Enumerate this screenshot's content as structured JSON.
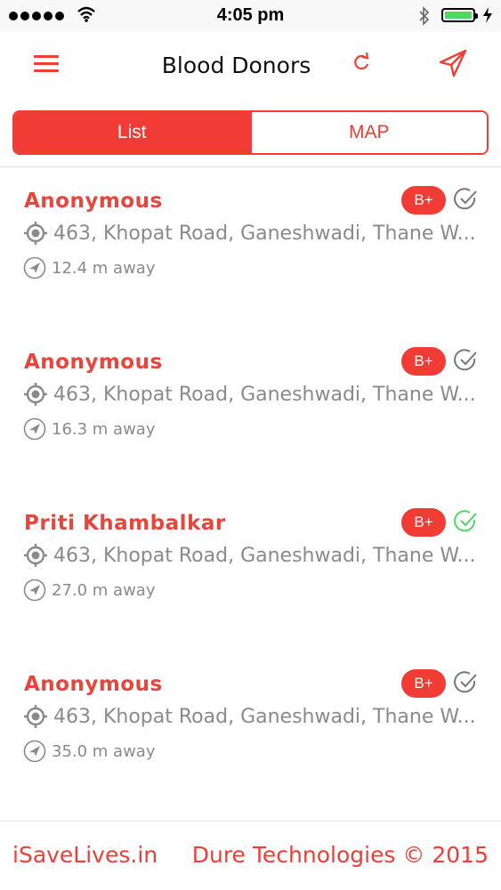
{
  "status_bar": {
    "time": "4:05 pm",
    "battery_color": "#4cd964"
  },
  "header": {
    "title": "Blood Donors",
    "menu_icon": "hamburger-menu-icon",
    "refresh_icon": "refresh-icon",
    "send_icon": "paper-plane-icon"
  },
  "tabs": [
    {
      "label": "List",
      "active": true
    },
    {
      "label": "MAP",
      "active": false
    }
  ],
  "donors": [
    {
      "name": "Anonymous",
      "blood_group": "B+",
      "address": "463, Khopat Road, Ganeshwadi, Thane W...",
      "distance": "12.4 m away",
      "verified": false
    },
    {
      "name": "Anonymous",
      "blood_group": "B+",
      "address": "463, Khopat Road, Ganeshwadi, Thane W...",
      "distance": "16.3 m away",
      "verified": false
    },
    {
      "name": "Priti Khambalkar",
      "blood_group": "B+",
      "address": "463, Khopat Road, Ganeshwadi, Thane W...",
      "distance": "27.0 m away",
      "verified": true
    },
    {
      "name": "Anonymous",
      "blood_group": "B+",
      "address": "463, Khopat Road, Ganeshwadi, Thane W...",
      "distance": "35.0 m away",
      "verified": false
    }
  ],
  "footer": {
    "left": "iSaveLives.in",
    "right": "Dure Technologies © 2015"
  },
  "colors": {
    "accent": "#f13b35",
    "verified": "#4cd964",
    "unverified": "#777777"
  }
}
